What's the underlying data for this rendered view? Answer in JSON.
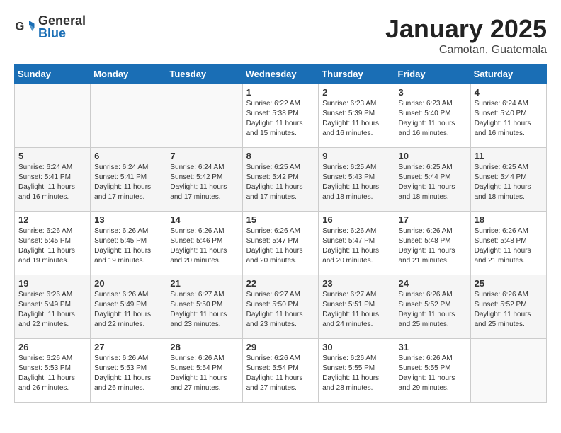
{
  "header": {
    "logo_general": "General",
    "logo_blue": "Blue",
    "month": "January 2025",
    "location": "Camotan, Guatemala"
  },
  "days_of_week": [
    "Sunday",
    "Monday",
    "Tuesday",
    "Wednesday",
    "Thursday",
    "Friday",
    "Saturday"
  ],
  "weeks": [
    [
      {
        "day": "",
        "info": ""
      },
      {
        "day": "",
        "info": ""
      },
      {
        "day": "",
        "info": ""
      },
      {
        "day": "1",
        "info": "Sunrise: 6:22 AM\nSunset: 5:38 PM\nDaylight: 11 hours and 15 minutes."
      },
      {
        "day": "2",
        "info": "Sunrise: 6:23 AM\nSunset: 5:39 PM\nDaylight: 11 hours and 16 minutes."
      },
      {
        "day": "3",
        "info": "Sunrise: 6:23 AM\nSunset: 5:40 PM\nDaylight: 11 hours and 16 minutes."
      },
      {
        "day": "4",
        "info": "Sunrise: 6:24 AM\nSunset: 5:40 PM\nDaylight: 11 hours and 16 minutes."
      }
    ],
    [
      {
        "day": "5",
        "info": "Sunrise: 6:24 AM\nSunset: 5:41 PM\nDaylight: 11 hours and 16 minutes."
      },
      {
        "day": "6",
        "info": "Sunrise: 6:24 AM\nSunset: 5:41 PM\nDaylight: 11 hours and 17 minutes."
      },
      {
        "day": "7",
        "info": "Sunrise: 6:24 AM\nSunset: 5:42 PM\nDaylight: 11 hours and 17 minutes."
      },
      {
        "day": "8",
        "info": "Sunrise: 6:25 AM\nSunset: 5:42 PM\nDaylight: 11 hours and 17 minutes."
      },
      {
        "day": "9",
        "info": "Sunrise: 6:25 AM\nSunset: 5:43 PM\nDaylight: 11 hours and 18 minutes."
      },
      {
        "day": "10",
        "info": "Sunrise: 6:25 AM\nSunset: 5:44 PM\nDaylight: 11 hours and 18 minutes."
      },
      {
        "day": "11",
        "info": "Sunrise: 6:25 AM\nSunset: 5:44 PM\nDaylight: 11 hours and 18 minutes."
      }
    ],
    [
      {
        "day": "12",
        "info": "Sunrise: 6:26 AM\nSunset: 5:45 PM\nDaylight: 11 hours and 19 minutes."
      },
      {
        "day": "13",
        "info": "Sunrise: 6:26 AM\nSunset: 5:45 PM\nDaylight: 11 hours and 19 minutes."
      },
      {
        "day": "14",
        "info": "Sunrise: 6:26 AM\nSunset: 5:46 PM\nDaylight: 11 hours and 20 minutes."
      },
      {
        "day": "15",
        "info": "Sunrise: 6:26 AM\nSunset: 5:47 PM\nDaylight: 11 hours and 20 minutes."
      },
      {
        "day": "16",
        "info": "Sunrise: 6:26 AM\nSunset: 5:47 PM\nDaylight: 11 hours and 20 minutes."
      },
      {
        "day": "17",
        "info": "Sunrise: 6:26 AM\nSunset: 5:48 PM\nDaylight: 11 hours and 21 minutes."
      },
      {
        "day": "18",
        "info": "Sunrise: 6:26 AM\nSunset: 5:48 PM\nDaylight: 11 hours and 21 minutes."
      }
    ],
    [
      {
        "day": "19",
        "info": "Sunrise: 6:26 AM\nSunset: 5:49 PM\nDaylight: 11 hours and 22 minutes."
      },
      {
        "day": "20",
        "info": "Sunrise: 6:26 AM\nSunset: 5:49 PM\nDaylight: 11 hours and 22 minutes."
      },
      {
        "day": "21",
        "info": "Sunrise: 6:27 AM\nSunset: 5:50 PM\nDaylight: 11 hours and 23 minutes."
      },
      {
        "day": "22",
        "info": "Sunrise: 6:27 AM\nSunset: 5:50 PM\nDaylight: 11 hours and 23 minutes."
      },
      {
        "day": "23",
        "info": "Sunrise: 6:27 AM\nSunset: 5:51 PM\nDaylight: 11 hours and 24 minutes."
      },
      {
        "day": "24",
        "info": "Sunrise: 6:26 AM\nSunset: 5:52 PM\nDaylight: 11 hours and 25 minutes."
      },
      {
        "day": "25",
        "info": "Sunrise: 6:26 AM\nSunset: 5:52 PM\nDaylight: 11 hours and 25 minutes."
      }
    ],
    [
      {
        "day": "26",
        "info": "Sunrise: 6:26 AM\nSunset: 5:53 PM\nDaylight: 11 hours and 26 minutes."
      },
      {
        "day": "27",
        "info": "Sunrise: 6:26 AM\nSunset: 5:53 PM\nDaylight: 11 hours and 26 minutes."
      },
      {
        "day": "28",
        "info": "Sunrise: 6:26 AM\nSunset: 5:54 PM\nDaylight: 11 hours and 27 minutes."
      },
      {
        "day": "29",
        "info": "Sunrise: 6:26 AM\nSunset: 5:54 PM\nDaylight: 11 hours and 27 minutes."
      },
      {
        "day": "30",
        "info": "Sunrise: 6:26 AM\nSunset: 5:55 PM\nDaylight: 11 hours and 28 minutes."
      },
      {
        "day": "31",
        "info": "Sunrise: 6:26 AM\nSunset: 5:55 PM\nDaylight: 11 hours and 29 minutes."
      },
      {
        "day": "",
        "info": ""
      }
    ]
  ]
}
